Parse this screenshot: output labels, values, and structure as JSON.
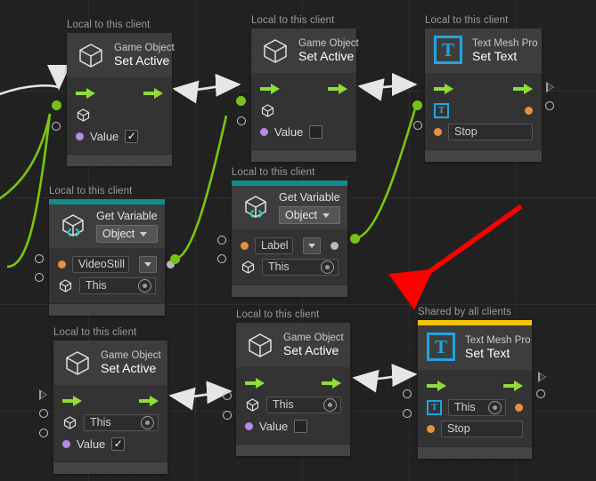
{
  "canvas": {
    "background": "#212121",
    "grid_major": "#2b2b2b",
    "accent_teal": "#128c8c",
    "accent_gold": "#f2c300",
    "flow_green": "#8fdc3c",
    "wire_green": "#7ac70c",
    "wire_white": "#e6e6e6",
    "annotation_red": "#ff0000"
  },
  "scopes": {
    "local": "Local to this client",
    "shared": "Shared by all clients"
  },
  "nodes": [
    {
      "id": "go-set-active-1",
      "scope_label": "Local to this client",
      "icon": "cube-icon",
      "title_top": "Game Object",
      "title_main": "Set Active",
      "accent": "none",
      "fields": [
        {
          "name": "value",
          "label": "Value",
          "type": "checkbox",
          "checked": true,
          "dot": "purple"
        }
      ],
      "object_field": {
        "type": "cube-port",
        "value": ""
      }
    },
    {
      "id": "go-set-active-2",
      "scope_label": "Local to this client",
      "icon": "cube-icon",
      "title_top": "Game Object",
      "title_main": "Set Active",
      "accent": "none",
      "fields": [
        {
          "name": "value",
          "label": "Value",
          "type": "checkbox",
          "checked": false,
          "dot": "purple"
        }
      ],
      "object_field": {
        "type": "cube-port",
        "value": ""
      }
    },
    {
      "id": "tmp-set-text-1",
      "scope_label": "Local to this client",
      "icon": "text-mesh-pro-icon",
      "title_top": "Text Mesh Pro",
      "title_main": "Set Text",
      "accent": "none",
      "fields": [
        {
          "name": "text",
          "label": "",
          "type": "text",
          "value": "Stop",
          "dot": "orange"
        }
      ]
    },
    {
      "id": "get-variable-1",
      "scope_label": "Local to this client",
      "icon": "get-variable-icon",
      "title_top": "Get Variable",
      "title_main": "",
      "accent": "teal",
      "kind_dropdown": "Object",
      "fields": [
        {
          "name": "variable-name",
          "type": "dropdown",
          "value": "VideoStill",
          "dot": "orange"
        },
        {
          "name": "source",
          "type": "object",
          "value": "This",
          "icon": "cube-icon"
        }
      ]
    },
    {
      "id": "get-variable-2",
      "scope_label": "Local to this client",
      "icon": "get-variable-icon",
      "title_top": "Get Variable",
      "title_main": "",
      "accent": "teal",
      "kind_dropdown": "Object",
      "fields": [
        {
          "name": "variable-name",
          "type": "dropdown",
          "value": "Label",
          "dot": "orange"
        },
        {
          "name": "source",
          "type": "object",
          "value": "This",
          "icon": "cube-icon"
        }
      ]
    },
    {
      "id": "go-set-active-3",
      "scope_label": "Local to this client",
      "icon": "cube-icon",
      "title_top": "Game Object",
      "title_main": "Set Active",
      "accent": "none",
      "fields": [
        {
          "name": "target",
          "type": "object",
          "value": "This",
          "icon": "cube-icon"
        },
        {
          "name": "value",
          "label": "Value",
          "type": "checkbox",
          "checked": true,
          "dot": "purple"
        }
      ]
    },
    {
      "id": "go-set-active-4",
      "scope_label": "Local to this client",
      "icon": "cube-icon",
      "title_top": "Game Object",
      "title_main": "Set Active",
      "accent": "none",
      "fields": [
        {
          "name": "target",
          "type": "object",
          "value": "This",
          "icon": "cube-icon"
        },
        {
          "name": "value",
          "label": "Value",
          "type": "checkbox",
          "checked": false,
          "dot": "purple"
        }
      ]
    },
    {
      "id": "tmp-set-text-2",
      "scope_label": "Shared by all clients",
      "icon": "text-mesh-pro-icon",
      "title_top": "Text Mesh Pro",
      "title_main": "Set Text",
      "accent": "gold",
      "fields": [
        {
          "name": "target",
          "type": "object",
          "value": "This",
          "icon": "text-mesh-pro-icon",
          "dot": "orange"
        },
        {
          "name": "text",
          "type": "text",
          "value": "Stop",
          "dot": "orange"
        }
      ]
    }
  ],
  "annotation": {
    "type": "arrow",
    "color": "#ff0000",
    "points_to": "tmp-set-text-2"
  }
}
